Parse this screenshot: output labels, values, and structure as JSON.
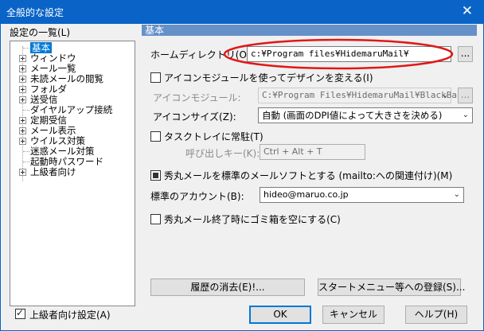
{
  "window": {
    "title": "全般的な設定",
    "close_glyph": "✕"
  },
  "tree": {
    "label": "設定の一覧(L)",
    "items": [
      {
        "label": "基本",
        "expandable": false,
        "selected": true
      },
      {
        "label": "ウィンドウ",
        "expandable": true
      },
      {
        "label": "メール一覧",
        "expandable": true
      },
      {
        "label": "未読メールの閲覧",
        "expandable": true
      },
      {
        "label": "フォルダ",
        "expandable": true
      },
      {
        "label": "送受信",
        "expandable": true
      },
      {
        "label": "ダイヤルアップ接続",
        "expandable": false
      },
      {
        "label": "定期受信",
        "expandable": true
      },
      {
        "label": "メール表示",
        "expandable": true
      },
      {
        "label": "ウイルス対策",
        "expandable": true
      },
      {
        "label": "迷惑メール対策",
        "expandable": false
      },
      {
        "label": "起動時パスワード",
        "expandable": false
      },
      {
        "label": "上級者向け",
        "expandable": true
      }
    ]
  },
  "advanced_checkbox": {
    "label": "上級者向け設定(A)",
    "checked": true
  },
  "section_header": "基本",
  "home_dir": {
    "label": "ホームディレクトリ(O):",
    "value": "c:¥Program files¥HidemaruMail¥",
    "browse": "..."
  },
  "icon_module_check": {
    "label": "アイコンモジュールを使ってデザインを変える(I)",
    "checked": false
  },
  "icon_module": {
    "label": "アイコンモジュール:",
    "value": "C:¥Program Files¥HidemaruMail¥BlackBa",
    "browse": "..."
  },
  "icon_size": {
    "label": "アイコンサイズ(Z):",
    "value": "自動 (画面のDPI値によって大きさを決める)"
  },
  "tasktray_check": {
    "label": "タスクトレイに常駐(T)",
    "checked": false
  },
  "hotkey": {
    "label": "呼び出しキー(K):",
    "value": "Ctrl + Alt + T"
  },
  "default_mailer_check": {
    "label": "秀丸メールを標準のメールソフトとする (mailto:への関連付け)(M)",
    "checked": true
  },
  "account": {
    "label": "標準のアカウント(B):",
    "value": "hideo@maruo.co.jp"
  },
  "trash_check": {
    "label": "秀丸メール終了時にゴミ箱を空にする(C)",
    "checked": false
  },
  "buttons": {
    "clear_history": "履歴の消去(E)!...",
    "start_menu": "スタートメニュー等への登録(S)...",
    "ok": "OK",
    "cancel": "キャンセル",
    "help": "ヘルプ(H)"
  },
  "colors": {
    "titlebar": "#0a64c8",
    "accent": "#0078d7",
    "header": "#6590c8",
    "highlight_oval": "#e01818"
  }
}
